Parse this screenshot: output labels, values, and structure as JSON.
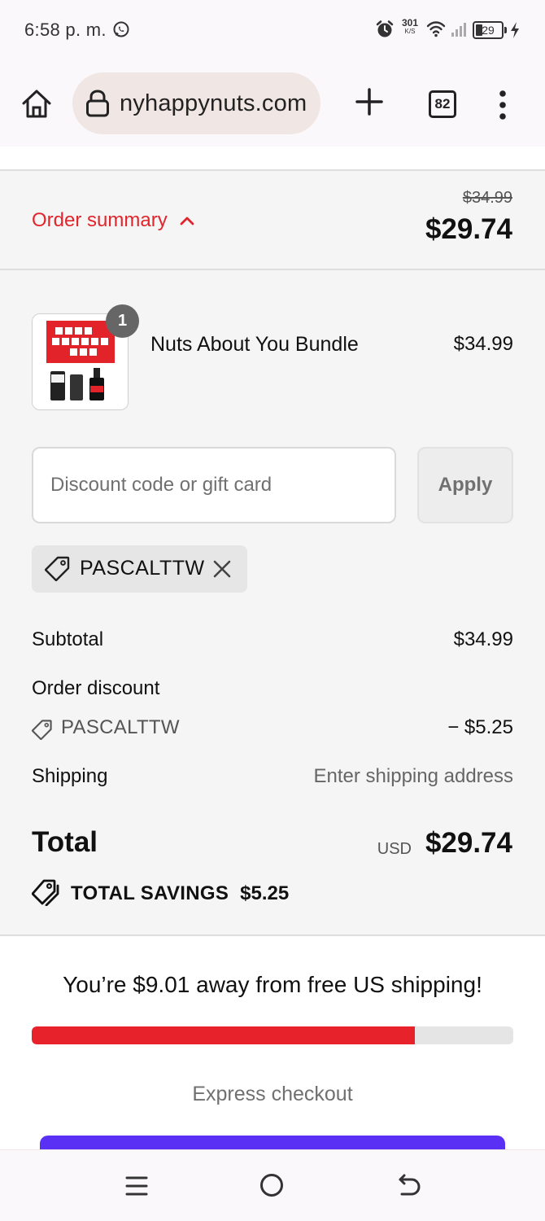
{
  "status_bar": {
    "time": "6:58 p. m.",
    "net_speed_value": "301",
    "net_speed_unit": "K/S",
    "battery": "29"
  },
  "browser": {
    "url": "nyhappynuts.com",
    "tab_count": "82"
  },
  "order_summary": {
    "toggle_label": "Order summary",
    "original_price": "$34.99",
    "total_price": "$29.74"
  },
  "product": {
    "quantity": "1",
    "name": "Nuts About You Bundle",
    "price": "$34.99"
  },
  "discount": {
    "placeholder": "Discount code or gift card",
    "apply_label": "Apply",
    "applied_code": "PASCALTTW"
  },
  "breakdown": {
    "subtotal_label": "Subtotal",
    "subtotal_value": "$34.99",
    "order_discount_label": "Order discount",
    "discount_code": "PASCALTTW",
    "discount_value": "− $5.25",
    "shipping_label": "Shipping",
    "shipping_value": "Enter shipping address"
  },
  "total": {
    "label": "Total",
    "currency": "USD",
    "amount": "$29.74"
  },
  "savings": {
    "label": "TOTAL SAVINGS",
    "amount": "$5.25"
  },
  "free_shipping": {
    "message": "You’re $9.01 away from free US shipping!",
    "progress_fraction": 0.795
  },
  "express": {
    "label": "Express checkout"
  },
  "colors": {
    "accent_red": "#e0262c",
    "progress_red": "#e7222a",
    "express_button": "#5a31f4"
  }
}
